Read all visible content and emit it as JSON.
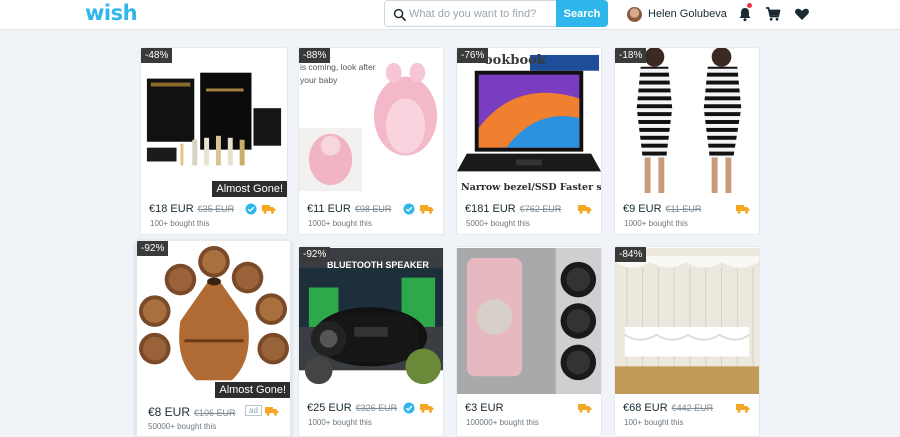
{
  "header": {
    "logo": "wish",
    "search_placeholder": "What do you want to find?",
    "search_value": "",
    "search_button": "Search",
    "user_name": "Helen Golubeva",
    "icons": [
      "search-icon",
      "bell-icon",
      "cart-icon",
      "heart-icon"
    ]
  },
  "products": [
    {
      "discount": "-48%",
      "price": "€18 EUR",
      "original_price": "€35 EUR",
      "bought": "100+ bought this",
      "tag": "Almost Gone!",
      "verified": true,
      "shipping": "truck-icon"
    },
    {
      "discount": "-88%",
      "price": "€11 EUR",
      "original_price": "€98 EUR",
      "bought": "1000+ bought this",
      "verified": true,
      "shipping": "truck-icon",
      "image_text": "is coming, look after your baby"
    },
    {
      "discount": "-76%",
      "price": "€181 EUR",
      "original_price": "€762 EUR",
      "bought": "5000+ bought this",
      "shipping": "truck-icon",
      "image_text": "Narrow bezel/SSD Faster speed",
      "image_text_top": "ookbook"
    },
    {
      "discount": "-18%",
      "price": "€9 EUR",
      "original_price": "€11 EUR",
      "bought": "1000+ bought this",
      "shipping": "truck-icon"
    },
    {
      "discount": "-92%",
      "price": "€8 EUR",
      "original_price": "€106 EUR",
      "bought": "50000+ bought this",
      "tag": "Almost Gone!",
      "ad": "ad",
      "shipping": "truck-icon"
    },
    {
      "discount": "-92%",
      "price": "€25 EUR",
      "original_price": "€326 EUR",
      "bought": "1000+ bought this",
      "verified": true,
      "shipping": "truck-icon",
      "image_text": "BLUETOOTH SPEAKER"
    },
    {
      "discount": "",
      "price": "€3 EUR",
      "original_price": "",
      "bought": "100000+ bought this",
      "shipping": "truck-icon"
    },
    {
      "discount": "-84%",
      "price": "€68 EUR",
      "original_price": "€442 EUR",
      "bought": "100+ bought this",
      "shipping": "truck-icon"
    }
  ],
  "colors": {
    "brand": "#2fb7ec",
    "truck": "#f5a623",
    "verified": "#2fb7ec"
  }
}
